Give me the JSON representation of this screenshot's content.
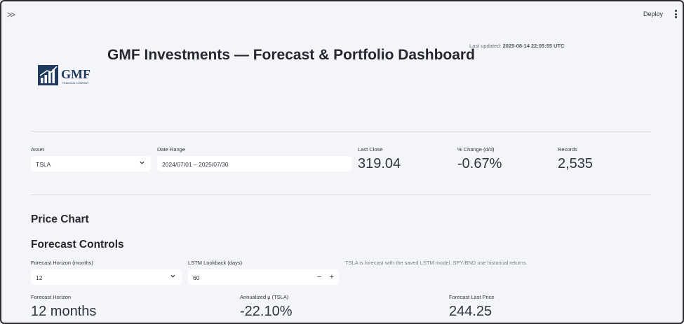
{
  "toolbar": {
    "deploy_label": "Deploy"
  },
  "header": {
    "title": "GMF Investments — Forecast & Portfolio Dashboard",
    "last_updated_label": "Last updated:",
    "last_updated_value": "2025-08-14 22:05:55 UTC",
    "logo_text": "GMF",
    "logo_subtext": "FINANCIAL COMPANY"
  },
  "filters": {
    "asset_label": "Asset",
    "asset_value": "TSLA",
    "date_range_label": "Date Range",
    "date_range_value": "2024/07/01 – 2025/07/30"
  },
  "metrics": [
    {
      "label": "Last Close",
      "value": "319.04"
    },
    {
      "label": "% Change (d/d)",
      "value": "-0.67%"
    },
    {
      "label": "Records",
      "value": "2,535"
    }
  ],
  "sections": {
    "price_chart": "Price Chart",
    "forecast_controls": "Forecast Controls"
  },
  "forecast": {
    "horizon_label": "Forecast Horizon (months)",
    "horizon_value": "12",
    "lookback_label": "LSTM Lookback (days)",
    "lookback_value": "60",
    "caption": "TSLA is forecast with the saved LSTM model. SPY/BND use historical returns."
  },
  "forecast_metrics": [
    {
      "label": "Forecast Horizon",
      "value": "12 months"
    },
    {
      "label": "Annualized μ (TSLA)",
      "value": "-22.10%"
    },
    {
      "label": "Forecast Last Price",
      "value": "244.25"
    }
  ],
  "colors": {
    "background": "#f4f5f9",
    "logo_navy": "#1f3a5f"
  },
  "icons": [
    "double-chevron-right-icon",
    "kebab-menu-icon",
    "chevron-down-icon",
    "minus-icon",
    "plus-icon"
  ]
}
